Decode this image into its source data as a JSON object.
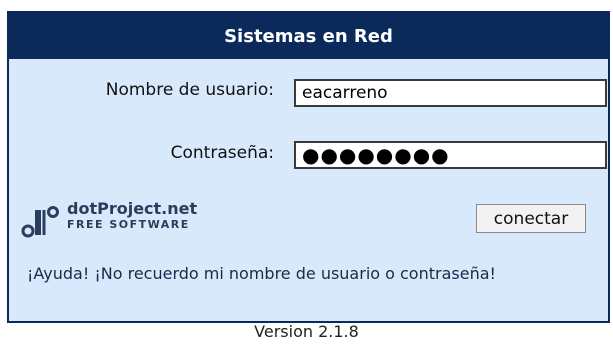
{
  "header": {
    "title": "Sistemas en Red"
  },
  "form": {
    "username_label": "Nombre de usuario:",
    "username_value": "eacarreno",
    "password_label": "Contraseña:",
    "password_mask": "●●●●●●●●"
  },
  "logo": {
    "icon": "dotproject-logo-icon",
    "title": "dotProject.net",
    "subtitle": "FREE SOFTWARE"
  },
  "buttons": {
    "connect_label": "conectar"
  },
  "help": {
    "text": "¡Ayuda! ¡No recuerdo mi nombre de usuario o contraseña!"
  },
  "footer": {
    "version": "Version 2.1.8"
  },
  "colors": {
    "header_bg": "#0b2a5b",
    "panel_bg": "#d7e9fb",
    "logo_text": "#2a3d5c"
  }
}
